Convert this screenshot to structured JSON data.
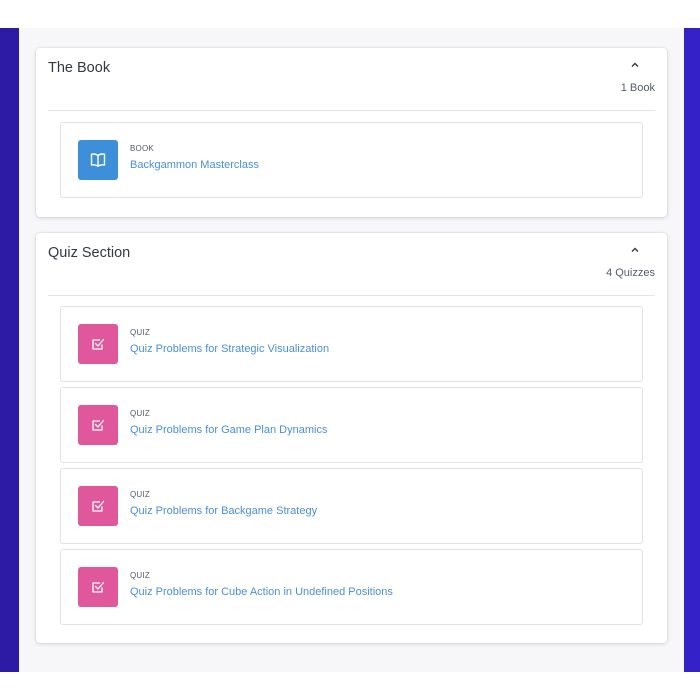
{
  "colors": {
    "left_bar": "#2d1ba6",
    "right_bar": "#3422c8",
    "link": "#4a8fd6",
    "book_icon_bg": "#3d8fd9",
    "quiz_icon_bg": "#e0579b"
  },
  "book_section": {
    "title": "The Book",
    "count": "1 Book",
    "toggle_icon": "chevron-up-icon",
    "items": [
      {
        "type": "BOOK",
        "title": "Backgammon Masterclass",
        "icon": "open-book-icon"
      }
    ]
  },
  "quiz_section": {
    "title": "Quiz Section",
    "count": "4 Quizzes",
    "toggle_icon": "chevron-up-icon",
    "items": [
      {
        "type": "QUIZ",
        "title": "Quiz Problems for Strategic Visualization",
        "icon": "checkbox-icon"
      },
      {
        "type": "QUIZ",
        "title": "Quiz Problems for Game Plan Dynamics",
        "icon": "checkbox-icon"
      },
      {
        "type": "QUIZ",
        "title": "Quiz Problems for Backgame Strategy",
        "icon": "checkbox-icon"
      },
      {
        "type": "QUIZ",
        "title": "Quiz Problems for Cube Action in Undefined Positions",
        "icon": "checkbox-icon"
      }
    ]
  }
}
